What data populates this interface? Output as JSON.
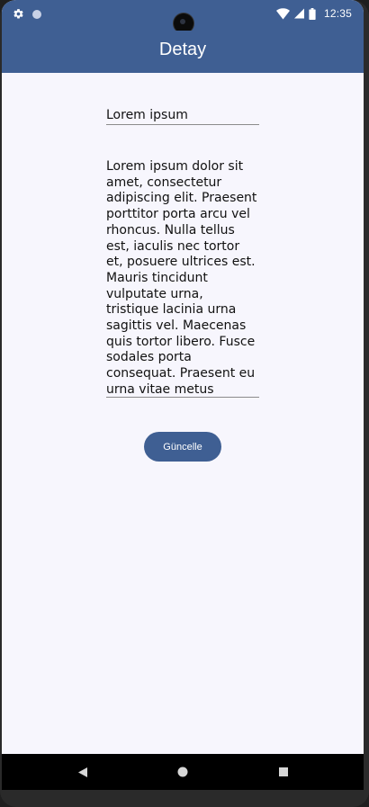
{
  "status_bar": {
    "time": "12:35",
    "left_icons": [
      "gear-icon",
      "circle-dot-icon"
    ],
    "right_icons": [
      "wifi-icon",
      "signal-icon",
      "battery-icon"
    ]
  },
  "app_bar": {
    "title": "Detay"
  },
  "form": {
    "title_value": "Lorem ipsum",
    "body_value": "Lorem ipsum dolor sit amet, consectetur adipiscing elit. Praesent porttitor porta arcu vel rhoncus. Nulla tellus est, iaculis nec tortor et, posuere ultrices est. Mauris tincidunt vulputate urna, tristique lacinia urna sagittis vel. Maecenas quis tortor libero. Fusce sodales porta consequat. Praesent eu urna vitae metus convallis luctus.",
    "update_label": "Güncelle"
  },
  "nav_bar": {
    "icons": [
      "back-icon",
      "home-icon",
      "recents-icon"
    ]
  },
  "colors": {
    "primary": "#3f5f93",
    "background": "#f7f6fd",
    "text": "#111111"
  }
}
